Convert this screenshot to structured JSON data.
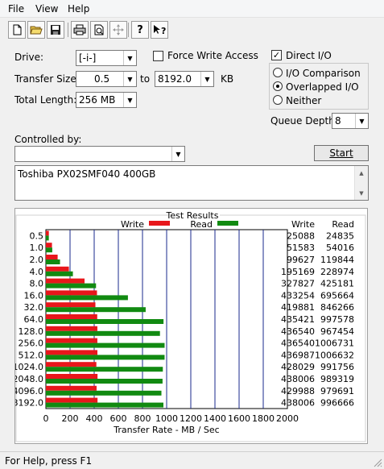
{
  "menu": [
    "File",
    "View",
    "Help"
  ],
  "toolbar": {
    "icons": [
      "new-document-icon",
      "open-folder-icon",
      "save-icon",
      "print-icon",
      "print-preview-icon",
      "move-icon",
      "help-icon",
      "context-help-icon"
    ]
  },
  "settings": {
    "drive_label": "Drive:",
    "drive_value": "[-i-]",
    "force_write_label": "Force Write Access",
    "transfer_size_label": "Transfer Size:",
    "transfer_from": "0.5",
    "to_label": "to",
    "transfer_to": "8192.0",
    "kb_label": "KB",
    "total_length_label": "Total Length:",
    "total_length_value": "256 MB",
    "direct_io_label": "Direct I/O",
    "io_comparison_label": "I/O Comparison",
    "overlapped_io_label": "Overlapped I/O",
    "neither_label": "Neither",
    "queue_depth_label": "Queue Depth:",
    "queue_depth_value": "8",
    "controlled_by_label": "Controlled by:",
    "controlled_by_value": "",
    "start_label": "Start",
    "description": "Toshiba PX02SMF040 400GB"
  },
  "results": {
    "title": "Test Results",
    "legend_write": "Write",
    "legend_read": "Read",
    "col_write": "Write",
    "col_read": "Read",
    "write_color": "#e8161b",
    "read_color": "#118a11"
  },
  "chart_data": {
    "type": "bar",
    "orientation": "horizontal",
    "categories": [
      "0.5",
      "1.0",
      "2.0",
      "4.0",
      "8.0",
      "16.0",
      "32.0",
      "64.0",
      "128.0",
      "256.0",
      "512.0",
      "1024.0",
      "2048.0",
      "4096.0",
      "8192.0"
    ],
    "series": [
      {
        "name": "Write",
        "values": [
          24.5,
          50.4,
          97.3,
          190.6,
          320.1,
          423.1,
          410.0,
          425.2,
          426.3,
          426.3,
          426.7,
          418.0,
          427.7,
          419.9,
          427.7
        ],
        "labels": [
          "25088",
          "51583",
          "99627",
          "195169",
          "327827",
          "433254",
          "419881",
          "435421",
          "436540",
          "436540",
          "436987",
          "428029",
          "438006",
          "429988",
          "438006"
        ]
      },
      {
        "name": "Read",
        "values": [
          24.3,
          52.8,
          117.0,
          223.6,
          415.2,
          679.4,
          826.4,
          974.2,
          944.7,
          983.1,
          983.0,
          968.5,
          966.1,
          956.7,
          973.3
        ],
        "labels": [
          "24835",
          "54016",
          "119844",
          "228974",
          "425181",
          "695664",
          "846266",
          "997578",
          "967454",
          "1006731",
          "1006632",
          "991756",
          "989319",
          "979691",
          "996666"
        ]
      }
    ],
    "xlabel": "Transfer Rate - MB / Sec",
    "xlim": [
      0,
      2000
    ],
    "xticks": [
      "0",
      "200",
      "400",
      "600",
      "800",
      "1000",
      "1200",
      "1400",
      "1600",
      "1800",
      "2000"
    ],
    "legend": "top-center"
  },
  "status": {
    "text": "For Help, press F1"
  }
}
